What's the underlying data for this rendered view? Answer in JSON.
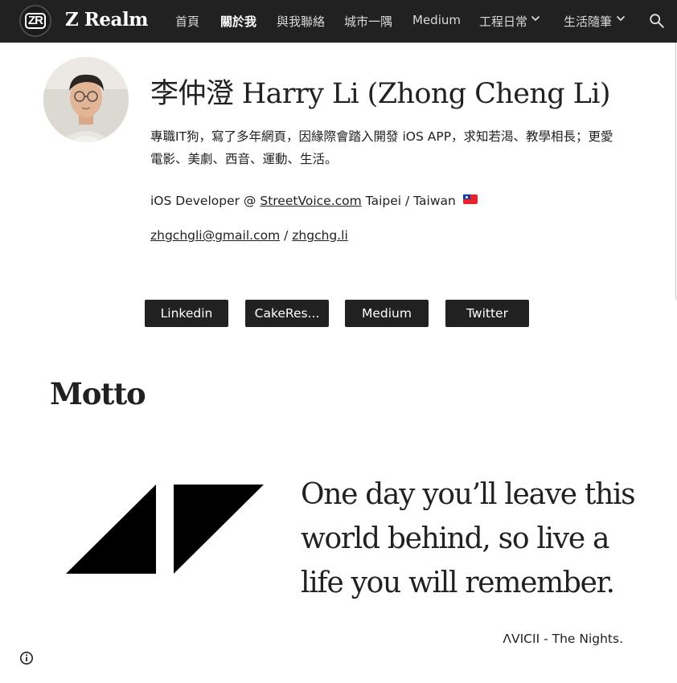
{
  "site": {
    "logo_text": "ZR",
    "title": "Z Realm"
  },
  "nav": {
    "items": [
      {
        "label": "首頁"
      },
      {
        "label": "關於我",
        "active": true
      },
      {
        "label": "與我聯絡"
      },
      {
        "label": "城市一隅"
      },
      {
        "label": "Medium"
      },
      {
        "label": "工程日常",
        "has_dropdown": true
      },
      {
        "label": "生活隨筆",
        "has_dropdown": true
      }
    ],
    "search_icon": "search-icon"
  },
  "profile": {
    "name": "李仲澄 Harry Li (Zhong Cheng Li)",
    "bio_line1": "專職IT狗，寫了多年網頁，因緣際會踏入開發 iOS APP，求知若渴、教學相長；更愛",
    "bio_line2": "電影、美劇、西音、運動、生活。",
    "job_prefix": "iOS Developer @ ",
    "job_company": "StreetVoice.com",
    "job_location": " Taipei / Taiwan",
    "email": "zhgchgli@gmail.com",
    "contact_separator": " / ",
    "website": "zhgchg.li"
  },
  "social_buttons": [
    {
      "label": "Linkedin"
    },
    {
      "label": "CakeRes..."
    },
    {
      "label": "Medium"
    },
    {
      "label": "Twitter"
    }
  ],
  "motto": {
    "heading": "Motto",
    "quote": "One day you’ll leave this world behind, so live a life you will remember.",
    "source": "ΛVICII - The Nights."
  },
  "colors": {
    "topbar": "#212121",
    "text": "#212121",
    "button": "#212121",
    "button_text": "#ffffff"
  }
}
